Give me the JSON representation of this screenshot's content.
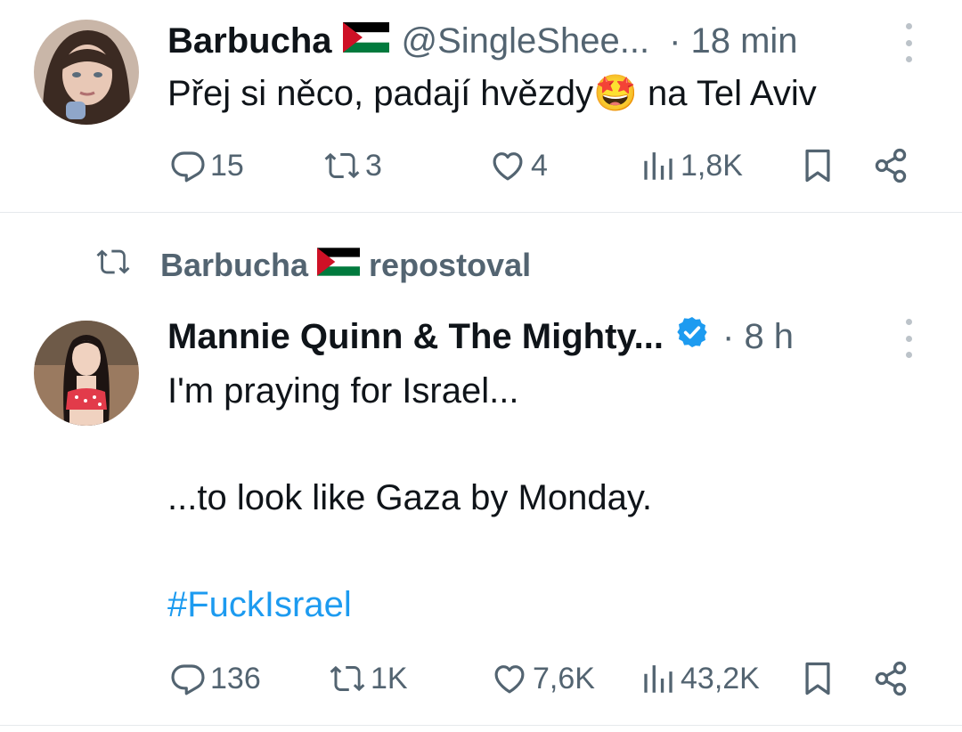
{
  "tweets": [
    {
      "display_name": "Barbucha",
      "handle": "@SingleShee...",
      "time": "· 18 min",
      "text": "Přej si něco, padají hvězdy🤩 na Tel Aviv",
      "actions": {
        "replies": "15",
        "reposts": "3",
        "likes": "4",
        "views": "1,8K"
      }
    },
    {
      "repost_by": "Barbucha",
      "repost_label": "repostoval",
      "display_name": "Mannie Quinn & The Mighty...",
      "time": "· 8 h",
      "lines": [
        "I'm praying for Israel...",
        "...to look like Gaza by Monday."
      ],
      "hashtag": "#FuckIsrael",
      "actions": {
        "replies": "136",
        "reposts": "1K",
        "likes": "7,6K",
        "views": "43,2K"
      }
    }
  ],
  "colors": {
    "text": "#0f1419",
    "secondary": "#536471",
    "link": "#1d9bf0",
    "verified": "#1d9bf0",
    "divider": "#e6e9ec"
  },
  "icons": [
    "reply-icon",
    "repost-icon",
    "like-icon",
    "views-icon",
    "bookmark-icon",
    "share-icon",
    "more-icon",
    "verified-badge-icon",
    "palestine-flag-icon"
  ]
}
